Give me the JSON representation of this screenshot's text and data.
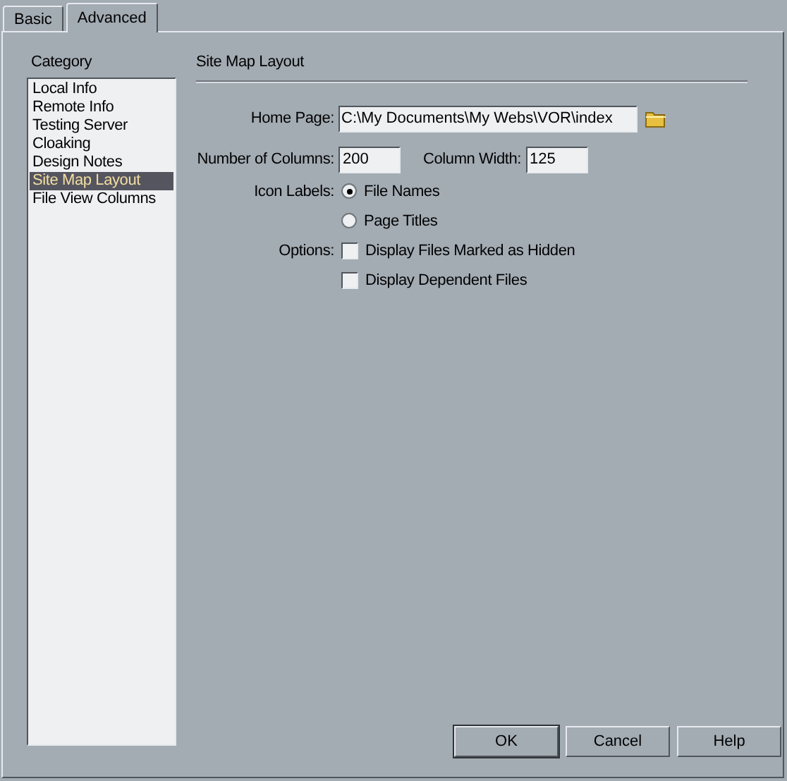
{
  "tabs": [
    {
      "label": "Basic",
      "selected": false
    },
    {
      "label": "Advanced",
      "selected": true
    }
  ],
  "category": {
    "label": "Category",
    "items": [
      {
        "label": "Local Info",
        "selected": false
      },
      {
        "label": "Remote Info",
        "selected": false
      },
      {
        "label": "Testing Server",
        "selected": false
      },
      {
        "label": "Cloaking",
        "selected": false
      },
      {
        "label": "Design Notes",
        "selected": false
      },
      {
        "label": "Site Map Layout",
        "selected": true
      },
      {
        "label": "File View Columns",
        "selected": false
      }
    ]
  },
  "section_title": "Site Map Layout",
  "home_page": {
    "label": "Home Page:",
    "value": "C:\\My Documents\\My Webs\\VOR\\index"
  },
  "number_of_columns": {
    "label": "Number of Columns:",
    "value": "200"
  },
  "column_width": {
    "label": "Column Width:",
    "value": "125"
  },
  "icon_labels": {
    "label": "Icon Labels:",
    "options": [
      {
        "label": "File Names",
        "selected": true
      },
      {
        "label": "Page Titles",
        "selected": false
      }
    ]
  },
  "options": {
    "label": "Options:",
    "items": [
      {
        "label": "Display Files Marked as Hidden",
        "checked": false
      },
      {
        "label": "Display Dependent Files",
        "checked": false
      }
    ]
  },
  "buttons": [
    "OK",
    "Cancel",
    "Help"
  ]
}
